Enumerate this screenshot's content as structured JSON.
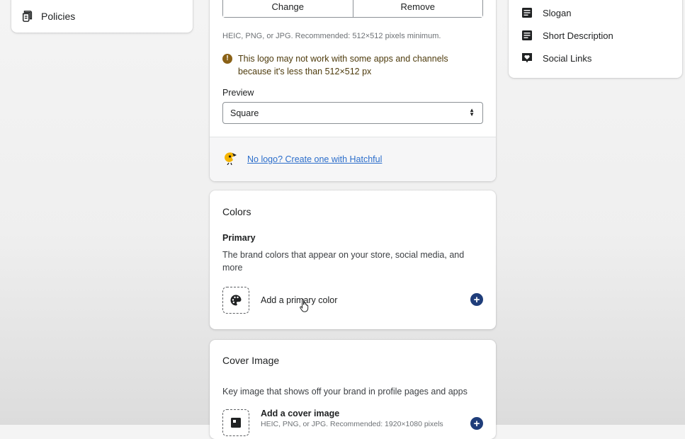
{
  "left_nav": {
    "items": [
      {
        "label": "Policies",
        "icon": "policies-icon"
      }
    ]
  },
  "right_panel": {
    "items": [
      {
        "label": "Slogan",
        "icon": "text-lines-icon"
      },
      {
        "label": "Short Description",
        "icon": "text-lines-icon"
      },
      {
        "label": "Social Links",
        "icon": "social-heart-icon"
      }
    ]
  },
  "logo_card": {
    "change_label": "Change",
    "remove_label": "Remove",
    "format_hint": "HEIC, PNG, or JPG. Recommended: 512×512 pixels minimum.",
    "warning_text": "This logo may not work with some apps and channels because it's less than 512×512 px",
    "preview_label": "Preview",
    "preview_value": "Square",
    "hatchful_link": "No logo? Create one with Hatchful"
  },
  "colors_card": {
    "title": "Colors",
    "primary_title": "Primary",
    "primary_desc": "The brand colors that appear on your store, social media, and more",
    "add_primary_label": "Add a primary color"
  },
  "cover_card": {
    "title": "Cover Image",
    "desc": "Key image that shows off your brand in profile pages and apps",
    "add_cover_label": "Add a cover image",
    "add_cover_hint": "HEIC, PNG, or JPG. Recommended: 1920×1080 pixels"
  },
  "colors": {
    "link": "#2c6ecb",
    "accent_button": "#1f3d7a",
    "warning": "#8a6116"
  }
}
